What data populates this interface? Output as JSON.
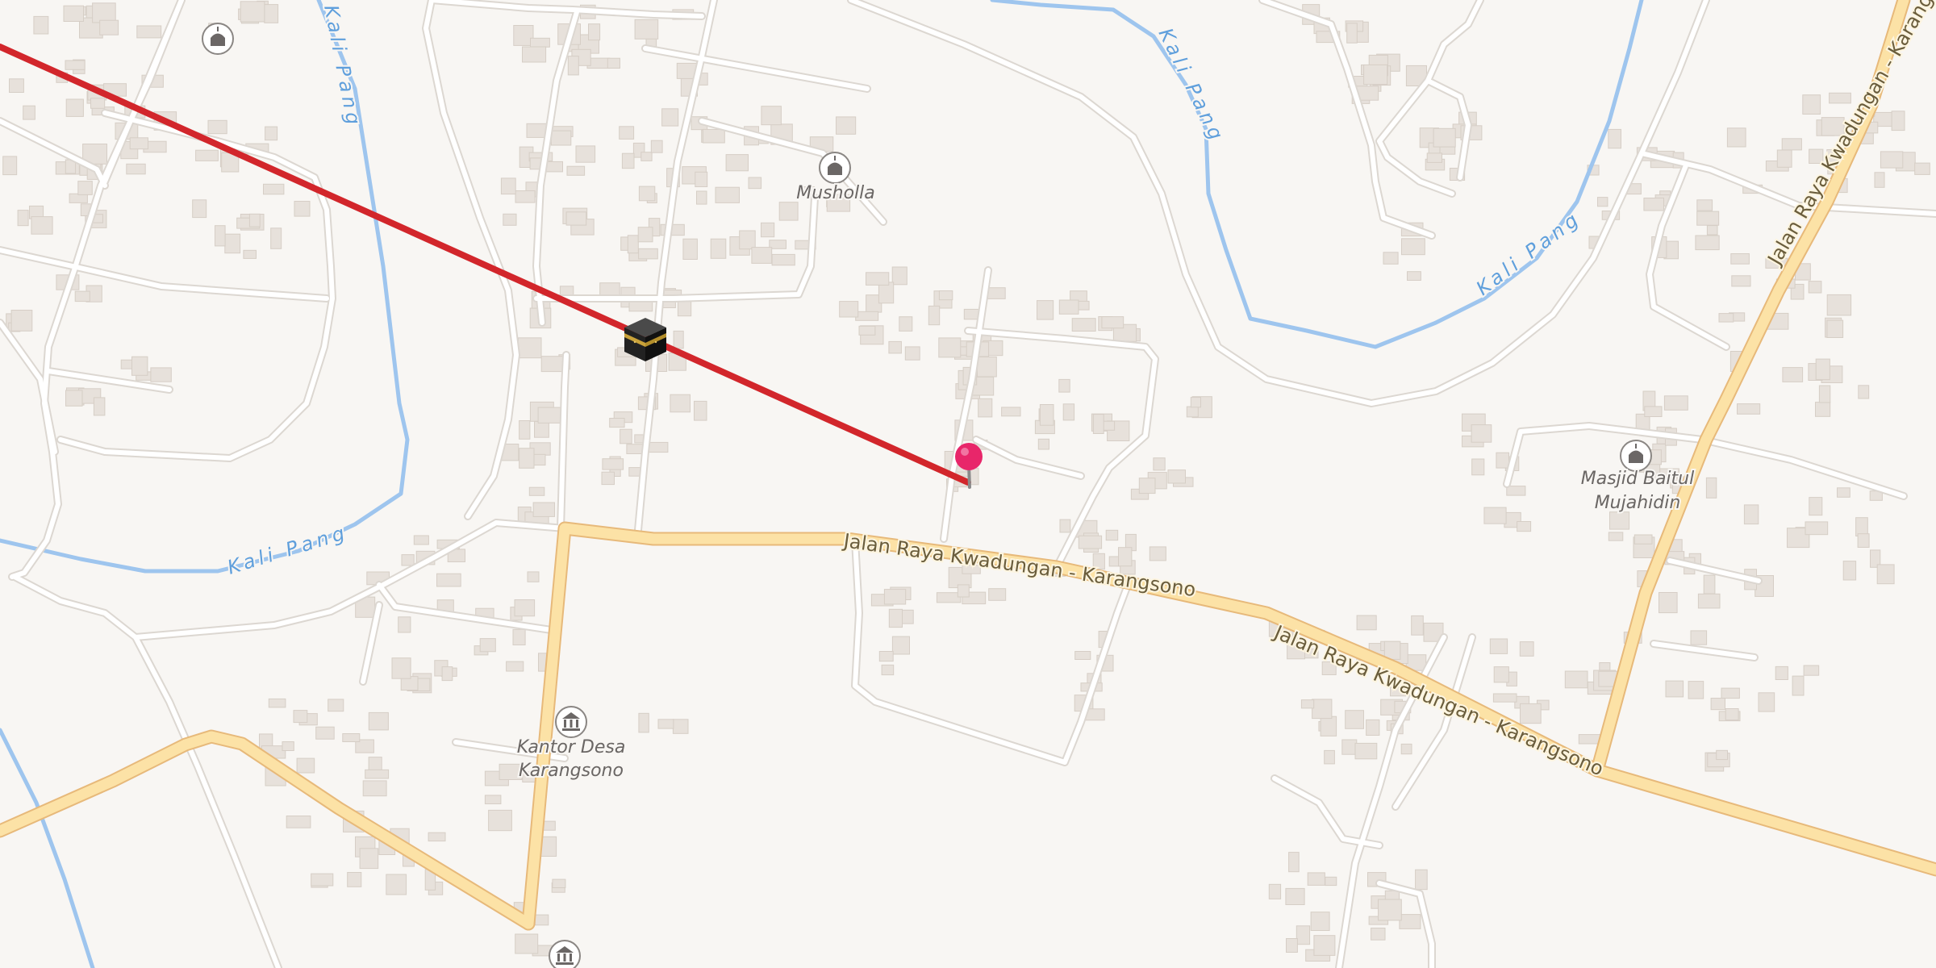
{
  "map": {
    "rivers": [
      {
        "id": "kali-pang-1",
        "name": "Kali Pang"
      },
      {
        "id": "kali-pang-2",
        "name": "Kali Pang"
      },
      {
        "id": "kali-pang-3",
        "name": "Kali Pang"
      },
      {
        "id": "kali-pang-4",
        "name": "Kali Pang"
      }
    ],
    "roads": [
      {
        "id": "road-1",
        "name": "Jalan Raya Kwadungan - Karangsono"
      },
      {
        "id": "road-2",
        "name": "Jalan Raya Kwadungan - Karangsono"
      },
      {
        "id": "road-3",
        "name": "Jalan Raya Kwadungan - Karangsono"
      }
    ],
    "pois": [
      {
        "id": "musholla",
        "name": "Musholla",
        "icon": "mosque-icon"
      },
      {
        "id": "masjid",
        "name_line1": "Masjid Baitul",
        "name_line2": "Mujahidin",
        "icon": "mosque-icon"
      },
      {
        "id": "kantor-desa",
        "name_line1": "Kantor Desa",
        "name_line2": "Karangsono",
        "icon": "government-building-icon"
      },
      {
        "id": "mosque-top-left",
        "icon": "mosque-icon"
      },
      {
        "id": "gov-bottom",
        "icon": "government-building-icon"
      }
    ],
    "qibla_marker": {
      "icon": "kaaba-icon"
    },
    "location_pin": {
      "icon": "map-pin-icon",
      "color": "#e8266a"
    },
    "colors": {
      "background": "#f8f6f3",
      "building": "#e7e1db",
      "minor_road": "#ffffff",
      "main_road": "#fce2a6",
      "river": "#9ec5ee",
      "qibla_line": "#d2262b"
    }
  }
}
